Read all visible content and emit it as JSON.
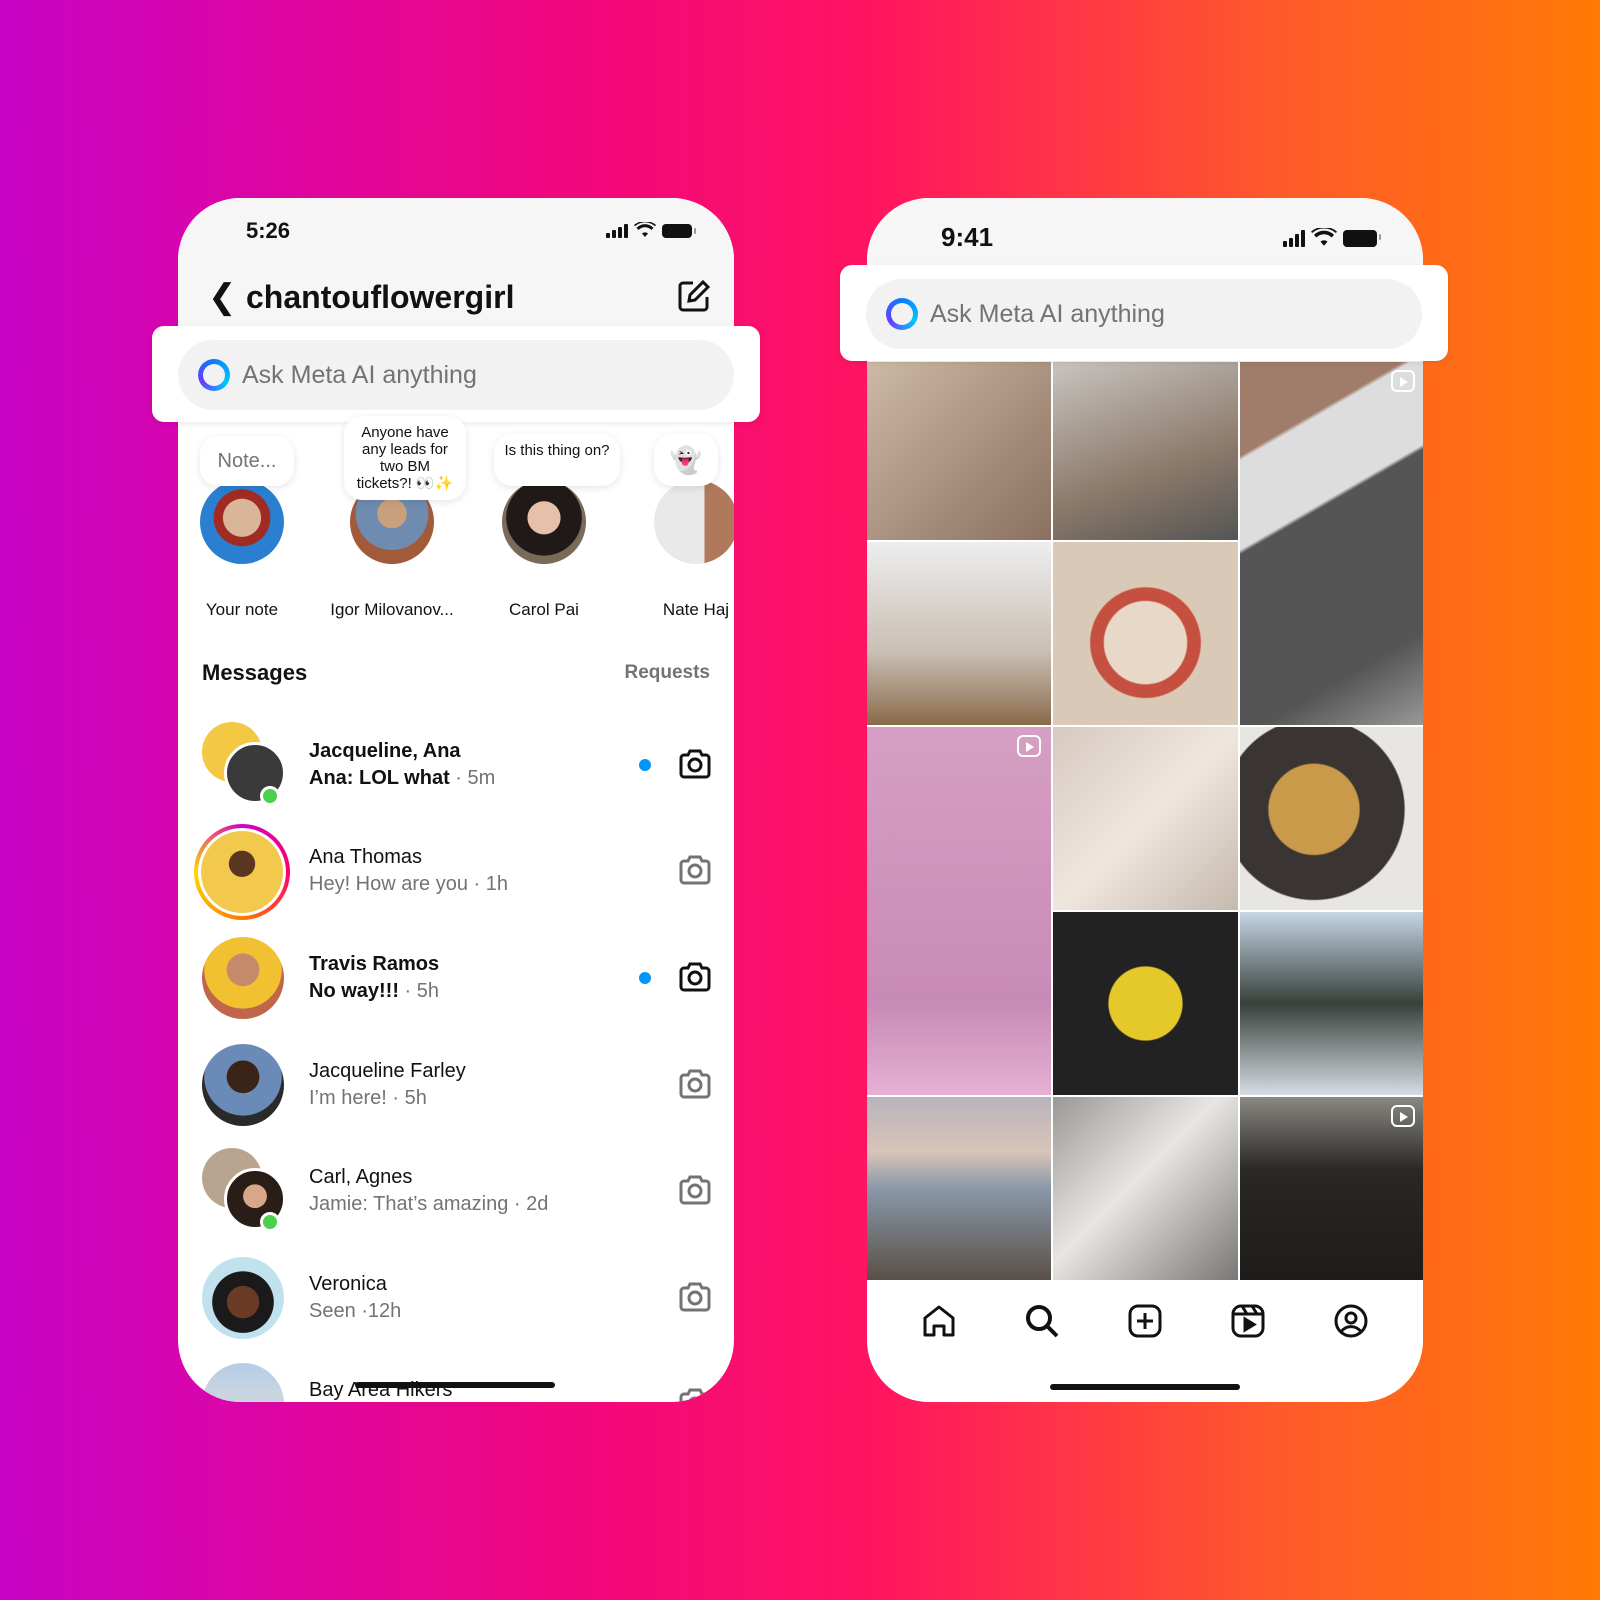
{
  "left_phone": {
    "status": {
      "time": "5:26"
    },
    "header": {
      "username": "chantouflowergirl",
      "back_icon": "chevron-left-icon",
      "compose_icon": "compose-icon"
    },
    "meta_ai": {
      "placeholder": "Ask Meta AI anything",
      "icon": "meta-ai-ring-icon"
    },
    "notes": [
      {
        "bubble": "Note...",
        "name": "Your note"
      },
      {
        "bubble": "Anyone have any leads for two BM tickets?! 👀✨",
        "name": "Igor Milovanov..."
      },
      {
        "bubble": "Is this thing on?",
        "name": "Carol Pai"
      },
      {
        "bubble": "👻",
        "name": "Nate Haj"
      }
    ],
    "messages_title": "Messages",
    "requests_label": "Requests",
    "threads": [
      {
        "name": "Jacqueline, Ana",
        "message": "Ana: LOL what",
        "time": " · 5m",
        "unread": true
      },
      {
        "name": "Ana Thomas",
        "message": "Hey! How are you",
        "time": " · 1h",
        "unread": false
      },
      {
        "name": "Travis Ramos",
        "message": "No way!!!",
        "time": " · 5h",
        "unread": true
      },
      {
        "name": "Jacqueline Farley",
        "message": "I’m here!",
        "time": " · 5h",
        "unread": false
      },
      {
        "name": "Carl, Agnes",
        "message": "Jamie: That’s amazing",
        "time": " · 2d",
        "unread": false
      },
      {
        "name": "Veronica",
        "message": "Seen",
        "time": " ·12h",
        "unread": false
      },
      {
        "name": "Bay Area Hikers",
        "message": "",
        "time": "",
        "unread": false
      }
    ],
    "colors": {
      "unread_dot": "#0095f6",
      "online": "#4cd14c"
    }
  },
  "right_phone": {
    "status": {
      "time": "9:41"
    },
    "meta_ai": {
      "placeholder": "Ask Meta AI anything"
    },
    "tabs": [
      "home-icon",
      "search-icon",
      "create-icon",
      "reels-icon",
      "profile-icon"
    ]
  }
}
